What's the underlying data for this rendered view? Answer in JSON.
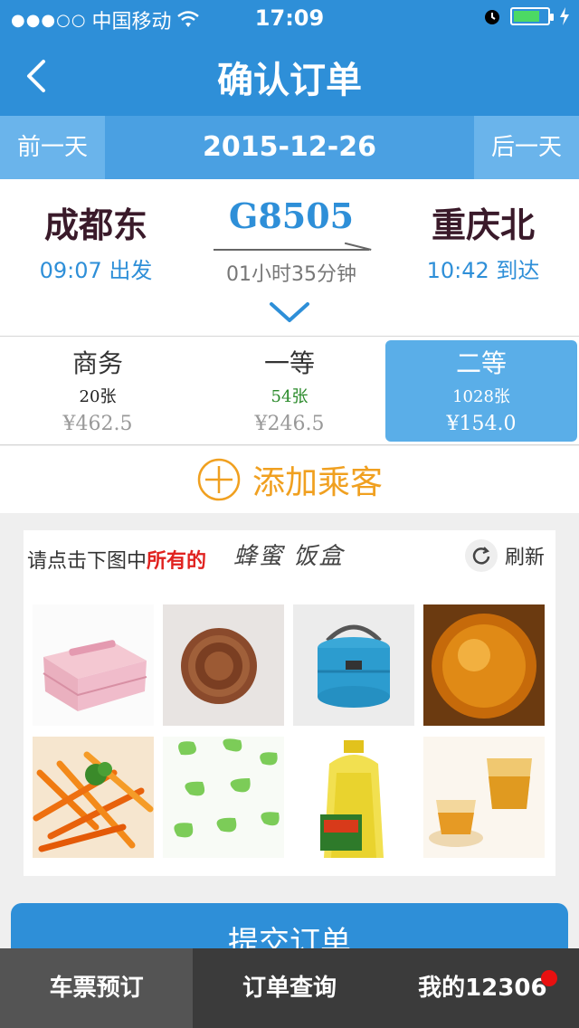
{
  "status_bar": {
    "carrier": "中国移动",
    "time": "17:09",
    "battery_level": 0.8
  },
  "nav": {
    "title": "确认订单"
  },
  "date_bar": {
    "prev_label": "前一天",
    "current_date": "2015-12-26",
    "next_label": "后一天"
  },
  "train": {
    "from_station": "成都东",
    "from_time": "09:07 出发",
    "train_number": "G8505",
    "duration": "01小时35分钟",
    "to_station": "重庆北",
    "to_time": "10:42 到达"
  },
  "seats": [
    {
      "name": "商务",
      "count": "20张",
      "price": "¥462.5",
      "selected": false
    },
    {
      "name": "一等",
      "count": "54张",
      "price": "¥246.5",
      "selected": false
    },
    {
      "name": "二等",
      "count": "1028张",
      "price": "¥154.0",
      "selected": true
    }
  ],
  "add_passenger": {
    "label": "添加乘客"
  },
  "captcha": {
    "prompt_prefix": "请点击下图中",
    "prompt_highlight": "所有的",
    "target": "蜂蜜 饭盒",
    "refresh_label": "刷新",
    "images": [
      "pink-lunchbox",
      "cookie",
      "blue-lunchbox",
      "honey-jar",
      "fried-fries",
      "ginkgo-leaves",
      "oil-bottle",
      "honey-tea"
    ]
  },
  "submit": {
    "label": "提交订单"
  },
  "tabs": [
    {
      "label": "车票预订",
      "active": true
    },
    {
      "label": "订单查询",
      "active": false
    },
    {
      "label": "我的12306",
      "active": false,
      "badge": true
    }
  ],
  "colors": {
    "primary": "#2e8fd8",
    "accent_orange": "#f0a020",
    "badge_red": "#e81010"
  }
}
